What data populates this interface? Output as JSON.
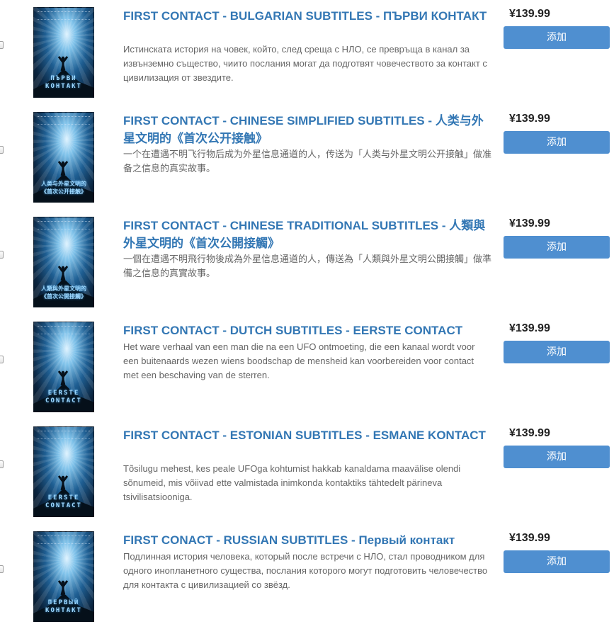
{
  "products": [
    {
      "title": "FIRST CONTACT - BULGARIAN SUBTITLES - ПЪРВИ КОНТАКТ",
      "description": "Истинската история на човек, който, след среща с НЛО, се превръща в канал за извънземно същество, чиито послания могат да подготвят човечеството за контакт с цивилизация от звездите.",
      "price": "¥139.99",
      "button": "添加",
      "cover_text": "ПЪРВИ\nКОНТАКТ"
    },
    {
      "title": "FIRST CONTACT - CHINESE SIMPLIFIED SUBTITLES - 人类与外星文明的《首次公开接触》",
      "description": "一个在遭遇不明飞行物后成为外星信息通道的人，传送为「人类与外星文明公开接触」做准备之信息的真实故事。",
      "price": "¥139.99",
      "button": "添加",
      "cover_text": "人类与外星文明的\n《首次公开接触》"
    },
    {
      "title": "FIRST CONTACT - CHINESE TRADITIONAL SUBTITLES - 人類與外星文明的《首次公開接觸》",
      "description": "一個在遭遇不明飛行物後成為外星信息通道的人，傳送為「人類與外星文明公開接觸」做準備之信息的真實故事。",
      "price": "¥139.99",
      "button": "添加",
      "cover_text": "人類與外星文明的\n《首次公開接觸》"
    },
    {
      "title": "FIRST CONTACT - DUTCH SUBTITLES - EERSTE CONTACT",
      "description": "Het ware verhaal van een man die na een UFO ontmoeting, die een kanaal wordt voor een buitenaards wezen wiens boodschap de mensheid kan voorbereiden voor contact met een beschaving van de sterren.",
      "price": "¥139.99",
      "button": "添加",
      "cover_text": "EERSTE\nCONTACT"
    },
    {
      "title": "FIRST CONTACT - ESTONIAN SUBTITLES - ESMANE KONTACT",
      "description": "Tõsilugu mehest, kes peale UFOga kohtumist hakkab kanaldama maavälise olendi sõnumeid, mis võiivad ette valmistada inimkonda kontaktiks tähtedelt pärineva tsivilisatsiooniga.",
      "price": "¥139.99",
      "button": "添加",
      "cover_text": "EERSTE\nCONTACT"
    },
    {
      "title": "FIRST CONACT - RUSSIAN SUBTITLES - Первый контакт",
      "description": "Подлинная история человека, который после встречи с НЛО, стал проводником для одного инопланетного существа, послания которого могут подготовить человечество для контакта с цивилизацией со звёзд.",
      "price": "¥139.99",
      "button": "添加",
      "cover_text": "ПЕРВЫЙ\nКОНТАКТ"
    }
  ]
}
